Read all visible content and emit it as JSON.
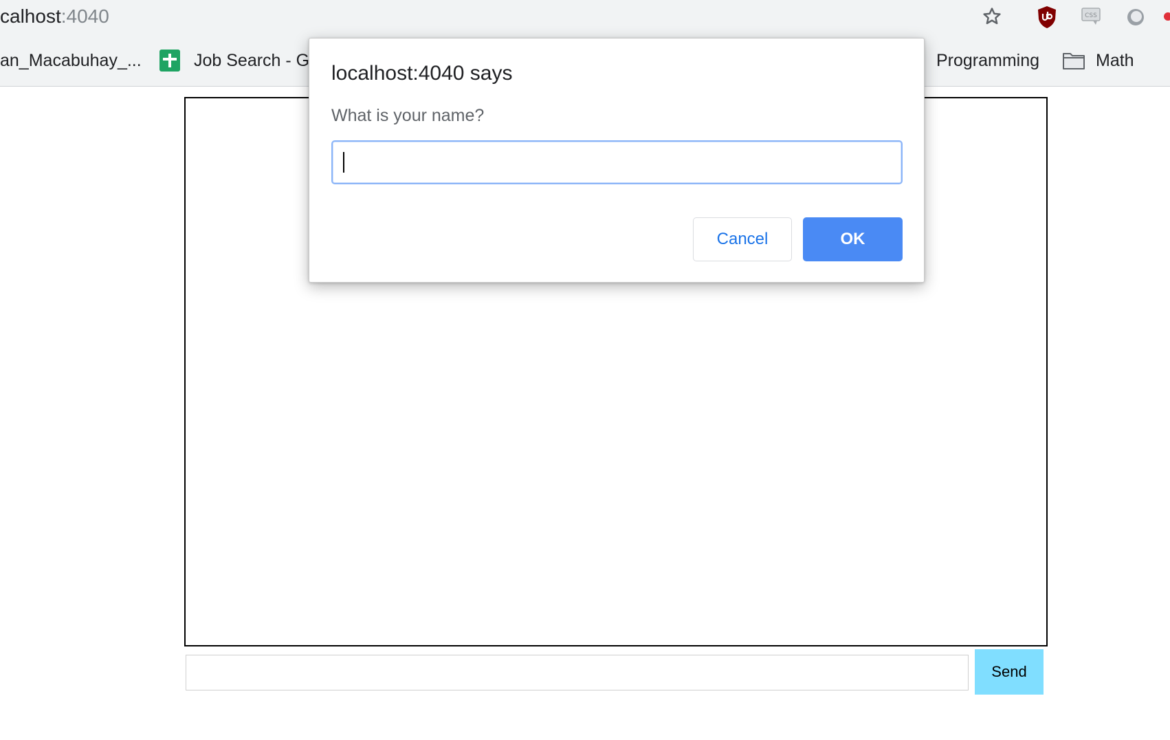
{
  "browser": {
    "url_host": "calhost",
    "url_port": ":4040",
    "bookmarks": [
      {
        "label": "an_Macabuhay_...",
        "icon": "none"
      },
      {
        "label": "Job Search - G",
        "icon": "google-sheets-icon"
      },
      {
        "label": "Programming",
        "icon": "none"
      },
      {
        "label": "Math",
        "icon": "folder-icon"
      }
    ],
    "extensions": [
      "star-icon",
      "ublock-origin-icon",
      "css-viewer-icon",
      "circle-extension-icon"
    ]
  },
  "dialog": {
    "title": "localhost:4040 says",
    "message": "What is your name?",
    "input_value": "",
    "cancel_label": "Cancel",
    "ok_label": "OK"
  },
  "chat": {
    "message_value": "",
    "send_label": "Send",
    "colors": {
      "send_bg": "#80deff",
      "ok_bg": "#4a8af4",
      "cancel_text": "#1a73e8"
    }
  }
}
